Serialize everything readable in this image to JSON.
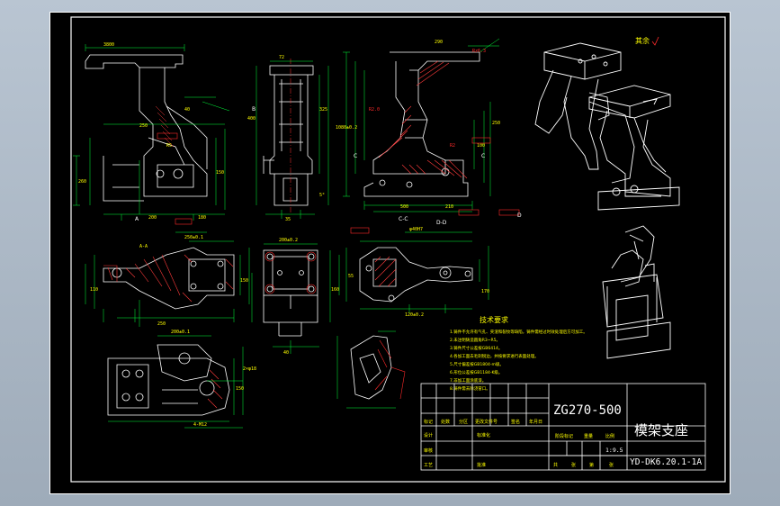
{
  "drawing": {
    "title_block": {
      "drawing_number": "ZG270-500",
      "part_name": "模架支座",
      "code": "YD-DK6.20.1-1A",
      "scale": "1:9.5",
      "row_labels": [
        "设计",
        "审核",
        "工艺"
      ],
      "header_labels": [
        "标记",
        "处数",
        "分区",
        "更改文件号",
        "签名",
        "年月日"
      ],
      "stage_labels": [
        "阶段标记",
        "重量",
        "比例"
      ],
      "sheet_labels": [
        "共",
        "张",
        "第",
        "张"
      ],
      "extra_labels": [
        "标准化",
        "批准"
      ]
    },
    "surface_note": "其余",
    "tech_requirements": {
      "heading": "技术要求",
      "items": [
        "1.铸件不允许有气孔、夹渣和裂纹等缺陷，铸件需经过时效处理后方可加工。",
        "2.未注明铸造圆角R3~R5。",
        "3.铸件尺寸公差按GB6414。",
        "4.各加工面去毛刺锐边，并按要求进行表面处理。",
        "5.尺寸偏差按GB1804-m级。",
        "6.形位公差按GB1184-K级。",
        "7.非加工面涂底漆。",
        "8.铸件需去除浇冒口。"
      ]
    },
    "section_labels": [
      "A",
      "B",
      "C",
      "D",
      "C-C",
      "D-D"
    ],
    "colors": {
      "background": "#000000",
      "border": "#ffffff",
      "geometry": "#ffffff",
      "dimension": "#00ff3a",
      "text_yellow": "#ffff00",
      "text_red": "#ff2a2a",
      "hatch": "#ff3b3b",
      "centerline": "#ff3333",
      "frame": "#a9b6c4"
    }
  }
}
